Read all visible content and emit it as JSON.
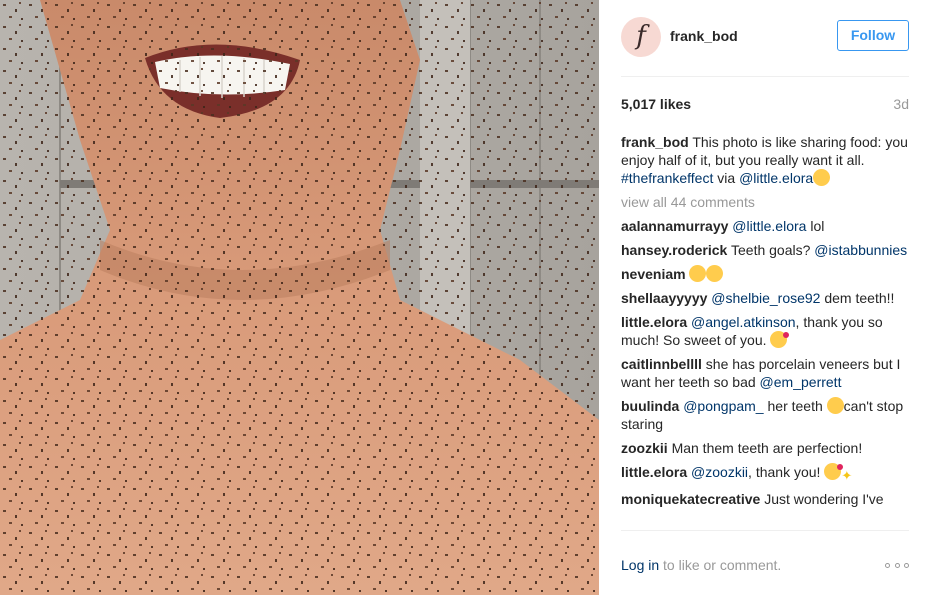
{
  "post": {
    "avatar_letter": "f",
    "username": "frank_bod",
    "follow_label": "Follow",
    "likes": "5,017 likes",
    "age": "3d"
  },
  "caption": {
    "user": "frank_bod",
    "text": "This photo is like sharing food: you enjoy half of it, but you really want it all.",
    "hashtag": "#thefrankeffect",
    "via": "via",
    "mention": "@little.elora"
  },
  "view_all": "view all 44 comments",
  "comments": [
    {
      "user": "aalannamurrayy",
      "mention": "@little.elora",
      "text": "lol"
    },
    {
      "user": "hansey.roderick",
      "text": "Teeth goals?",
      "mention": "@istabbunnies"
    },
    {
      "user": "neveniam"
    },
    {
      "user": "shellaayyyyy",
      "mention": "@shelbie_rose92",
      "text": "dem teeth!!"
    },
    {
      "user": "little.elora",
      "mention": "@angel.atkinson",
      "text": ", thank you so much! So sweet of you."
    },
    {
      "user": "caitlinnbellll",
      "text": "she has porcelain veneers but I want her teeth so bad",
      "mention": "@em_perrett"
    },
    {
      "user": "buulinda",
      "mention": "@pongpam_",
      "text": "her teeth",
      "text2": "can't stop staring"
    },
    {
      "user": "zoozkii",
      "text": "Man them teeth are perfection!"
    },
    {
      "user": "little.elora",
      "mention": "@zoozkii",
      "text": ", thank you!"
    },
    {
      "user": "moniquekatecreative",
      "text": "Just wondering I've"
    }
  ],
  "footer": {
    "login_link": "Log in",
    "login_rest": " to like or comment."
  },
  "colors": {
    "link": "#003569",
    "follow": "#3897f0",
    "muted": "#999999"
  },
  "icons": {
    "more": "more-options-icon"
  }
}
